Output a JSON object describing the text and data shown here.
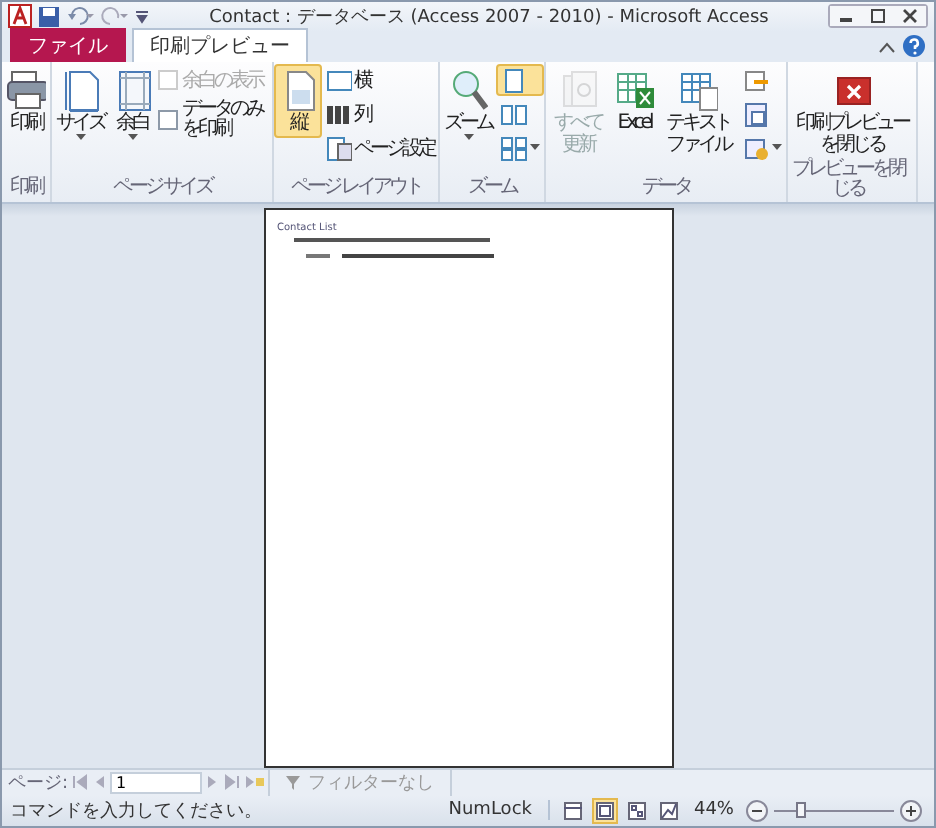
{
  "window": {
    "title": "Contact : データベース (Access 2007 - 2010) - Microsoft Access"
  },
  "tabs": [
    {
      "label": "ファイル",
      "kind": "file",
      "selected": false
    },
    {
      "label": "印刷プレビュー",
      "kind": "tab",
      "selected": true
    }
  ],
  "ribbon": [
    {
      "label": "印刷",
      "buttons": [
        {
          "kind": "large",
          "label": "印刷",
          "caret": false,
          "disabled": false,
          "selected": false
        }
      ]
    },
    {
      "label": "ページ サイズ",
      "buttons": [
        {
          "kind": "large",
          "label": "サイズ",
          "caret": true,
          "disabled": false,
          "selected": false
        },
        {
          "kind": "large",
          "label": "余白",
          "caret": true,
          "disabled": false,
          "selected": false
        },
        {
          "kind": "checks",
          "items": [
            {
              "label": "余白の表示",
              "checked": false,
              "disabled": true
            },
            {
              "label": "データのみを印刷",
              "checked": false,
              "disabled": false
            }
          ]
        }
      ]
    },
    {
      "label": "ページ レイアウト",
      "buttons": [
        {
          "kind": "large",
          "label": "縦",
          "caret": false,
          "disabled": false,
          "selected": true
        },
        {
          "kind": "smalls",
          "items": [
            {
              "label": "横"
            },
            {
              "label": "列"
            },
            {
              "label": "ページ設定"
            }
          ]
        }
      ]
    },
    {
      "label": "ズーム",
      "buttons": [
        {
          "kind": "large",
          "label": "ズーム",
          "caret": true,
          "disabled": false,
          "selected": false
        },
        {
          "kind": "iconstack",
          "items": [
            {
              "selected": true,
              "caret": false
            },
            {
              "selected": false,
              "caret": false
            },
            {
              "selected": false,
              "caret": true
            }
          ]
        }
      ]
    },
    {
      "label": "データ",
      "buttons": [
        {
          "kind": "large",
          "label": "すべて更新",
          "caret": false,
          "disabled": true,
          "selected": false
        },
        {
          "kind": "large",
          "label": "Excel",
          "caret": false,
          "disabled": false,
          "selected": false
        },
        {
          "kind": "large",
          "label": "テキストファイル",
          "caret": false,
          "disabled": false,
          "selected": false
        },
        {
          "kind": "iconstack",
          "items": [
            {
              "selected": false,
              "caret": false
            },
            {
              "selected": false,
              "caret": false
            },
            {
              "selected": false,
              "caret": true
            }
          ]
        }
      ]
    },
    {
      "label": "プレビューを閉じる",
      "buttons": [
        {
          "kind": "large",
          "label": "印刷プレビューを閉じる",
          "caret": false,
          "disabled": false,
          "selected": false
        }
      ]
    }
  ],
  "report": {
    "title": "Contact List"
  },
  "navigation": {
    "label": "ページ:",
    "value": "1",
    "filter": "フィルターなし",
    "filter_disabled": true
  },
  "status_bar": {
    "message": "コマンドを入力してください。",
    "numlock": "NumLock",
    "views": [
      {
        "selected": false
      },
      {
        "selected": true
      },
      {
        "selected": false
      },
      {
        "selected": false
      }
    ],
    "zoom": "44%",
    "zoom_slider": {
      "level": 0.22
    }
  }
}
